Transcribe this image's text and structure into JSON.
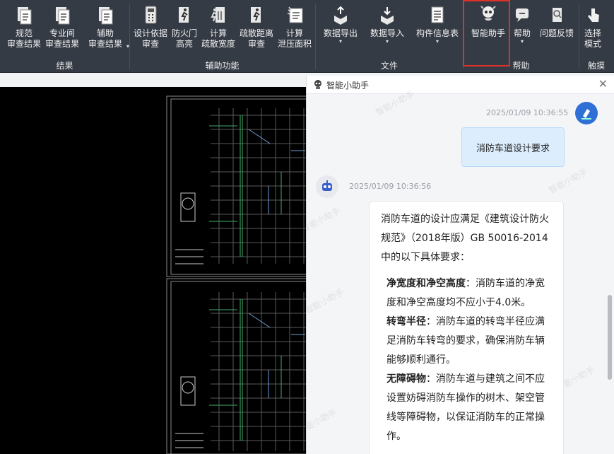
{
  "ribbon": {
    "buttons": [
      {
        "label": "规范\n审查结果"
      },
      {
        "label": "专业间\n审查结果"
      },
      {
        "label": "辅助\n审查结果"
      },
      {
        "label": "设计依据\n审查"
      },
      {
        "label": "防火门\n高亮"
      },
      {
        "label": "计算\n疏散宽度"
      },
      {
        "label": "疏散距离\n审查"
      },
      {
        "label": "计算\n泄压面积"
      },
      {
        "label": "数据导出"
      },
      {
        "label": "数据导入"
      },
      {
        "label": "构件信息表"
      },
      {
        "label": "智能助手"
      },
      {
        "label": "帮助"
      },
      {
        "label": "问题反馈"
      },
      {
        "label": "选择\n模式"
      }
    ],
    "groups": [
      "结果",
      "辅助功能",
      "文件",
      "帮助",
      "触摸"
    ]
  },
  "chat": {
    "title": "智能小助手",
    "user_time": "2025/01/09 10:36:55",
    "user_message": "消防车道设计要求",
    "bot_time": "2025/01/09 10:36:56",
    "bot_intro": "消防车道的设计应满足《建筑设计防火规范》（2018年版）GB 50016-2014 中的以下具体要求：",
    "items": [
      {
        "title": "净宽度和净空高度",
        "text": "：消防车道的净宽度和净空高度均不应小于4.0米。"
      },
      {
        "title": "转弯半径",
        "text": "：消防车道的转弯半径应满足消防车转弯的要求，确保消防车辆能够顺利通行。"
      },
      {
        "title": "无障碍物",
        "text": "：消防车道与建筑之间不应设置妨碍消防车操作的树木、架空管线等障碍物，以保证消防车的正常操作。"
      }
    ]
  },
  "colors": {
    "highlight": "#e0302a",
    "ribbon": "#353b45",
    "user_bubble": "#dceefe"
  }
}
